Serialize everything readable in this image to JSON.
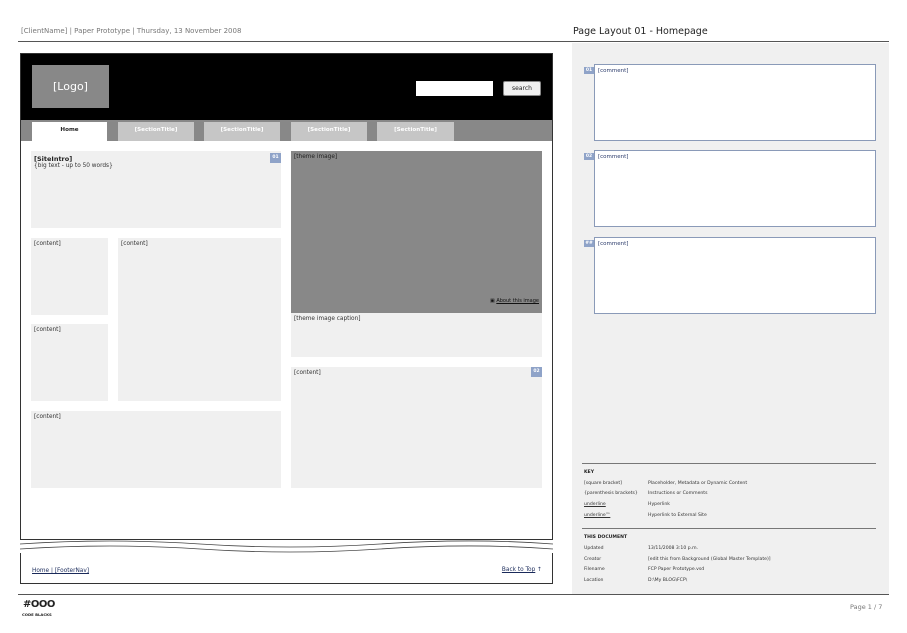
{
  "header": {
    "meta": "[ClientName] | Paper Prototype | Thursday, 13 November 2008",
    "page_title": "Page Layout 01 - Homepage"
  },
  "wireframe": {
    "logo": "[Logo]",
    "search_button": "search",
    "nav": {
      "home": "Home",
      "tabs": [
        "[SectionTitle]",
        "[SectionTitle]",
        "[SectionTitle]",
        "[SectionTitle]"
      ]
    },
    "site_intro_title": "[SiteIntro]",
    "site_intro_note": "{big text - up to 50 words}",
    "tag_01": "01",
    "tag_02": "02",
    "content_label": "[content]",
    "theme_image": "[theme image]",
    "about_icon": "▣",
    "about_link": "About this image",
    "theme_caption": "[theme image caption]",
    "footer_links": "Home | [FooterNav]",
    "back_to_top": "Back to Top",
    "back_to_top_arrow": "↑"
  },
  "comments": [
    {
      "badge": "01",
      "text": "[comment]"
    },
    {
      "badge": "02",
      "text": "[comment]"
    },
    {
      "badge": "##",
      "text": "[comment]"
    }
  ],
  "key": {
    "heading": "KEY",
    "rows": [
      {
        "term": "[square bracket]",
        "meaning": "Placeholder, Metadata or Dynamic Content"
      },
      {
        "term": "{parenthesis brackets}",
        "meaning": "Instructions or Comments"
      },
      {
        "term": "underline",
        "meaning": "Hyperlink"
      },
      {
        "term": "underline™",
        "meaning": "Hyperlink to External Site"
      }
    ]
  },
  "document": {
    "heading": "THIS DOCUMENT",
    "rows": [
      {
        "label": "Updated",
        "value": "13/11/2008 3:10 p.m."
      },
      {
        "label": "Creator",
        "value": "[edit this from Background (Global Master Template)]"
      },
      {
        "label": "Filename",
        "value": "FCP Paper Prototype.vsd"
      },
      {
        "label": "Location",
        "value": "D:\\My BLOG\\FCP\\"
      }
    ]
  },
  "footer": {
    "brand_mark": "#OOO",
    "brand_name": "CODE BLACKS",
    "page_number": "Page 1 / 7"
  },
  "colors": {
    "header_bg": "#000000",
    "nav_bg": "#888888",
    "placeholder_block": "#f0f0f0",
    "badge": "#8fa3c8",
    "comment_border": "#8a9ab8"
  }
}
